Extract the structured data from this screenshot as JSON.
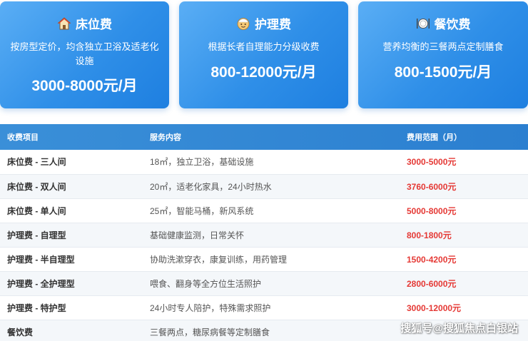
{
  "cards": [
    {
      "icon": "house-icon",
      "title": "床位费",
      "desc": "按房型定价，均含独立卫浴及适老化设施",
      "price": "3000-8000元/月"
    },
    {
      "icon": "caregiver-face-icon",
      "title": "护理费",
      "desc": "根据长者自理能力分级收费",
      "price": "800-12000元/月"
    },
    {
      "icon": "plate-cutlery-icon",
      "title": "餐饮费",
      "desc": "营养均衡的三餐两点定制膳食",
      "price": "800-1500元/月"
    }
  ],
  "table": {
    "headers": [
      "收费项目",
      "服务内容",
      "费用范围（月）"
    ],
    "rows": [
      {
        "item": "床位费 - 三人间",
        "content": "18㎡，独立卫浴，基础设施",
        "price": "3000-5000元"
      },
      {
        "item": "床位费 - 双人间",
        "content": "20㎡，适老化家具，24小时热水",
        "price": "3760-6000元"
      },
      {
        "item": "床位费 - 单人间",
        "content": "25㎡，智能马桶，新风系统",
        "price": "5000-8000元"
      },
      {
        "item": "护理费 - 自理型",
        "content": "基础健康监测，日常关怀",
        "price": "800-1800元"
      },
      {
        "item": "护理费 - 半自理型",
        "content": "协助洗漱穿衣，康复训练，用药管理",
        "price": "1500-4200元"
      },
      {
        "item": "护理费 - 全护理型",
        "content": "喂食、翻身等全方位生活照护",
        "price": "2800-6000元"
      },
      {
        "item": "护理费 - 特护型",
        "content": "24小时专人陪护，特殊需求照护",
        "price": "3000-12000元"
      },
      {
        "item": "餐饮费",
        "content": "三餐两点，糖尿病餐等定制膳食",
        "price": ""
      }
    ]
  },
  "watermark": "搜狐号@搜狐焦点白银站"
}
